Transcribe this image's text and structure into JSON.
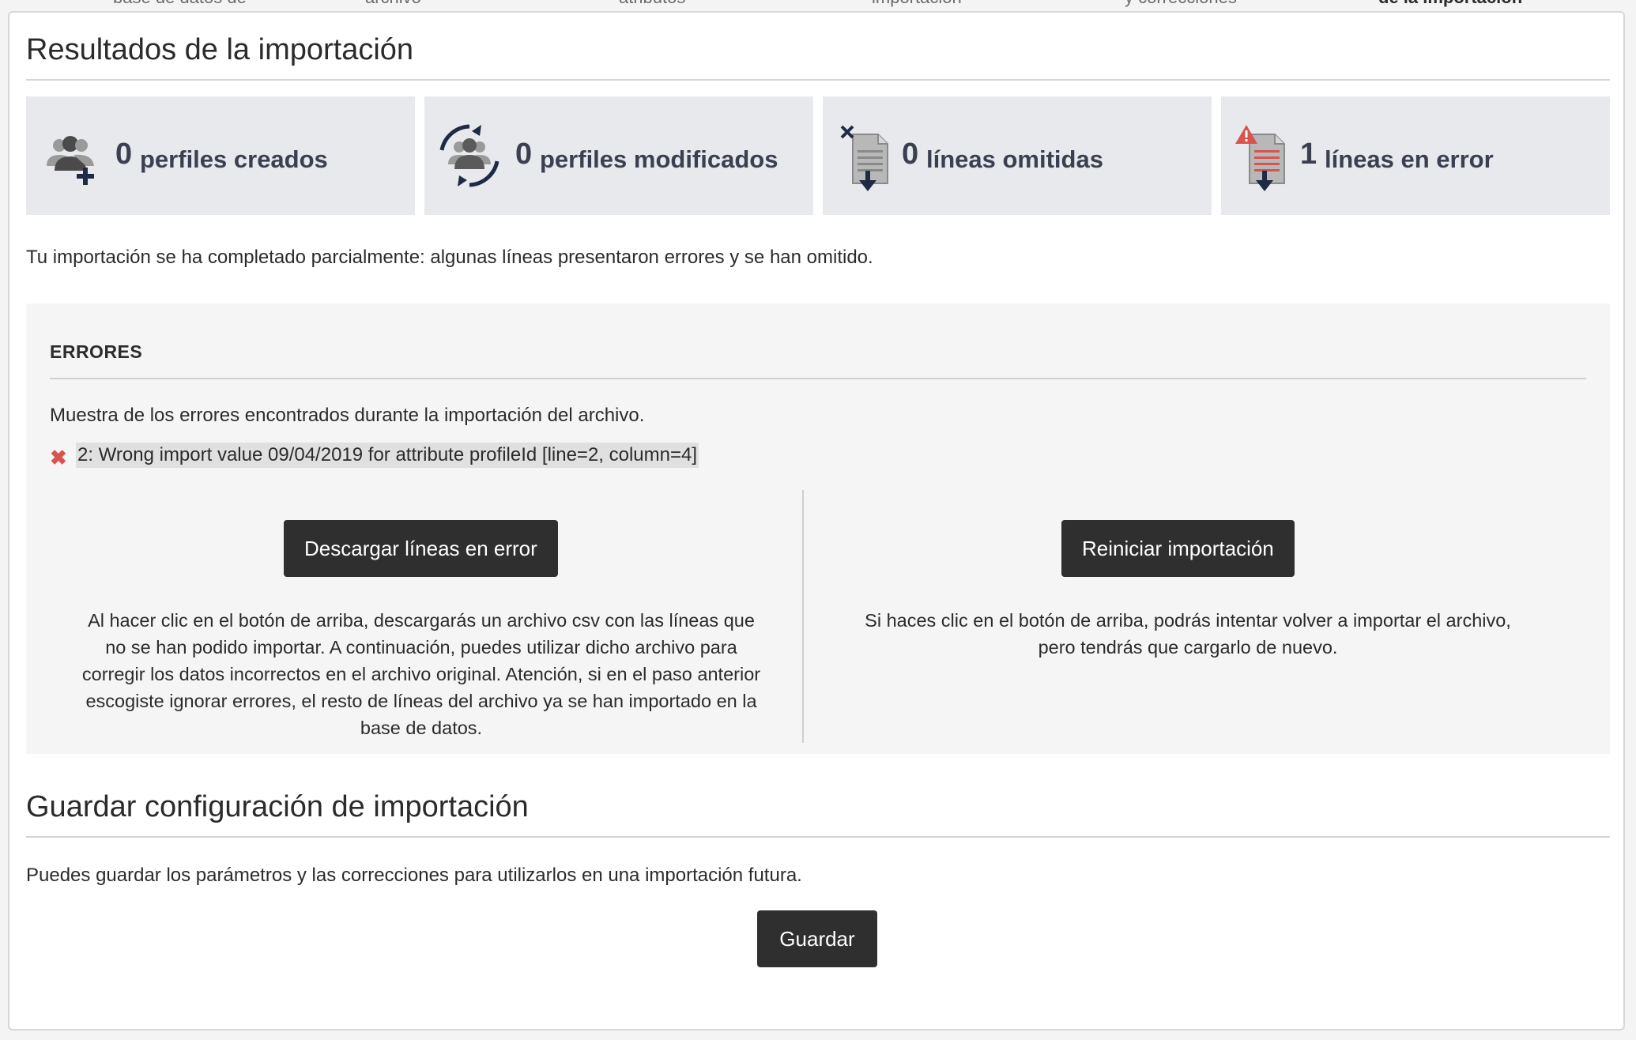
{
  "stepper": {
    "steps": [
      "base de datos de",
      "archivo",
      "atributos",
      "importación",
      "y correcciones",
      "de la importación"
    ]
  },
  "results": {
    "title": "Resultados de la importación",
    "stats": [
      {
        "icon": "users-add-icon",
        "count": "0",
        "label": "perfiles creados"
      },
      {
        "icon": "users-sync-icon",
        "count": "0",
        "label": "perfiles modificados"
      },
      {
        "icon": "file-skip-icon",
        "count": "0",
        "label": "líneas omitidas"
      },
      {
        "icon": "file-error-icon",
        "count": "1",
        "label": "líneas en error"
      }
    ],
    "summary": "Tu importación se ha completado parcialmente: algunas líneas presentaron errores y se han omitido."
  },
  "errors": {
    "title": "ERRORES",
    "description": "Muestra de los errores encontrados durante la importación del archivo.",
    "items": [
      "2: Wrong import value 09/04/2019 for attribute profileId [line=2, column=4]"
    ],
    "download_button": "Descargar líneas en error",
    "download_help": "Al hacer clic en el botón de arriba, descargarás un archivo csv con las líneas que no se han podido importar. A continuación, puedes utilizar dicho archivo para corregir los datos incorrectos en el archivo original. Atención, si en el paso anterior escogiste ignorar errores, el resto de líneas del archivo ya se han importado en la base de datos.",
    "restart_button": "Reiniciar importación",
    "restart_help": "Si haces clic en el botón de arriba, podrás intentar volver a importar el archivo, pero tendrás que cargarlo de nuevo."
  },
  "save": {
    "title": "Guardar configuración de importación",
    "description": "Puedes guardar los parámetros y las correcciones para utilizarlos en una importación futura.",
    "button": "Guardar"
  },
  "colors": {
    "button_bg": "#2f2f2f",
    "stat_bg": "#e8e9ec",
    "icon_navy": "#1f2a44",
    "error_red": "#d9534f"
  }
}
